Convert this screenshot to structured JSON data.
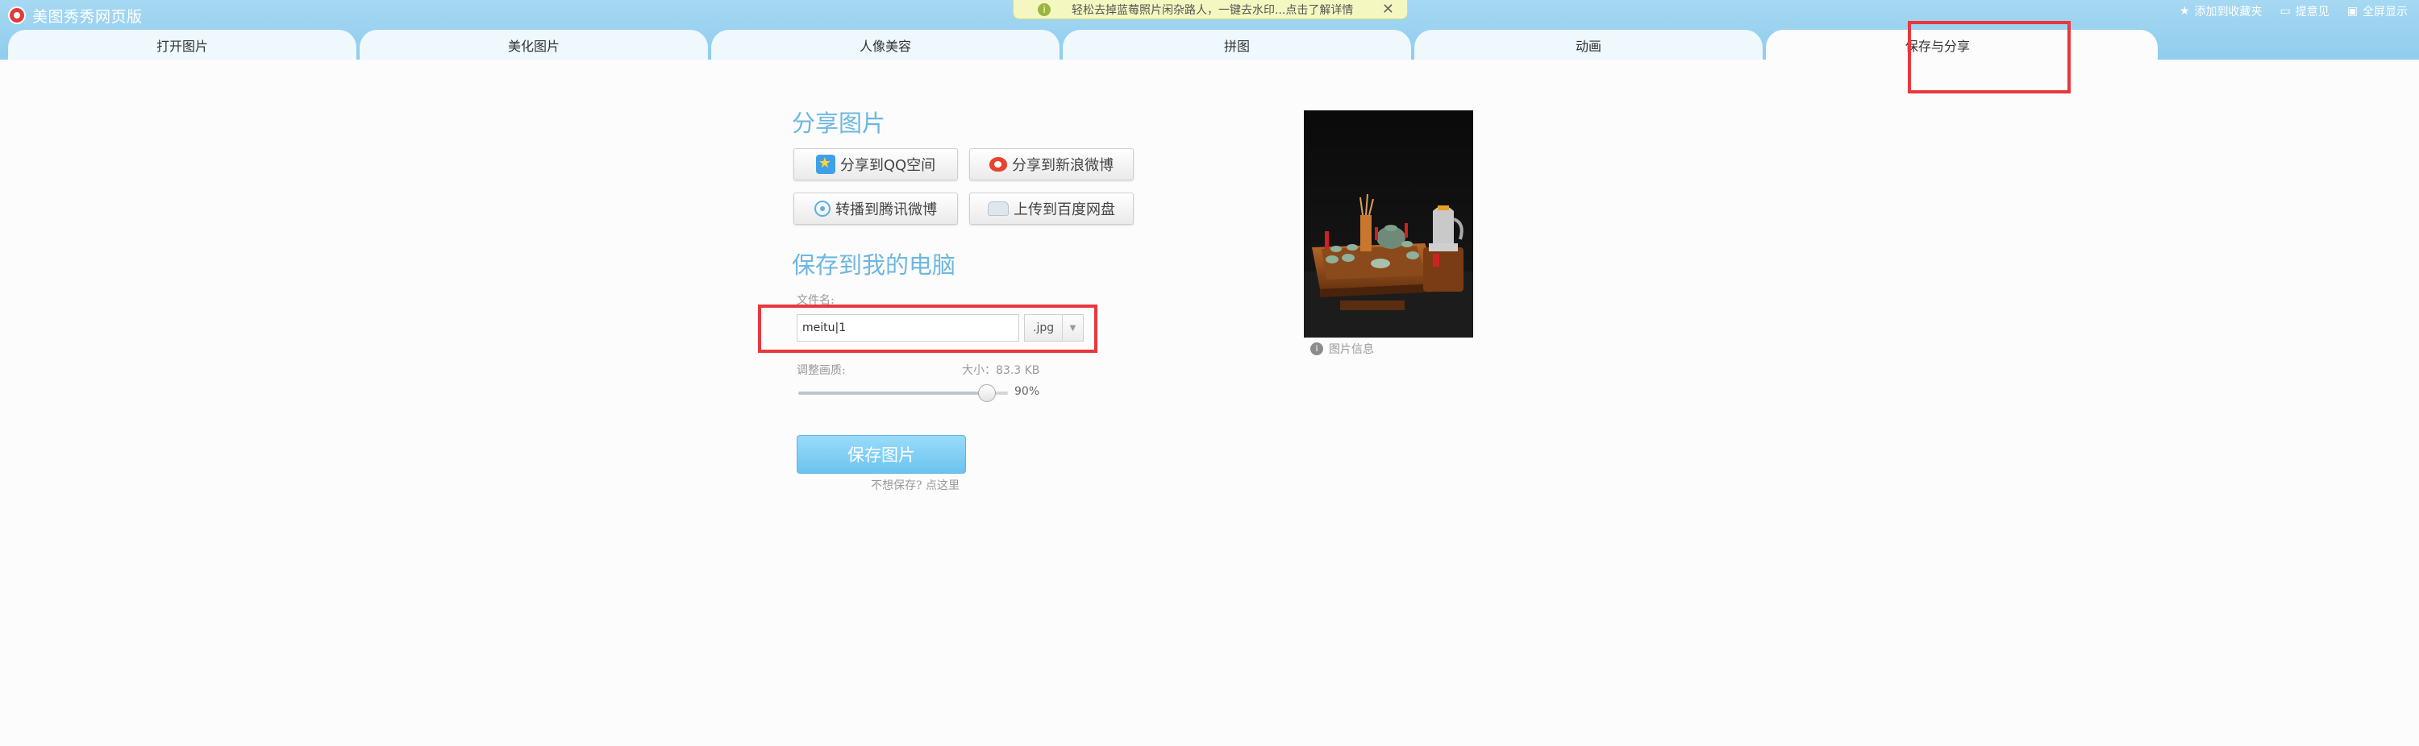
{
  "app": {
    "title": "美图秀秀网页版"
  },
  "notice": {
    "text": "轻松去掉蓝莓照片闲杂路人，一键去水印...点击了解详情",
    "close_label": "✕",
    "info_icon": "i"
  },
  "top_links": [
    {
      "label": "添加到收藏夹",
      "icon": "star-icon",
      "glyph": "★"
    },
    {
      "label": "提意见",
      "icon": "comment-icon",
      "glyph": "▭"
    },
    {
      "label": "全屏显示",
      "icon": "fullscreen-icon",
      "glyph": "▣"
    }
  ],
  "tabs": [
    {
      "label": "打开图片"
    },
    {
      "label": "美化图片"
    },
    {
      "label": "人像美容"
    },
    {
      "label": "拼图"
    },
    {
      "label": "动画"
    },
    {
      "label": "保存与分享",
      "active": true
    }
  ],
  "share": {
    "title": "分享图片",
    "buttons": [
      {
        "label": "分享到QQ空间",
        "icon": "qzone-icon"
      },
      {
        "label": "分享到新浪微博",
        "icon": "sina-weibo-icon"
      },
      {
        "label": "转播到腾讯微博",
        "icon": "tencent-weibo-icon"
      },
      {
        "label": "上传到百度网盘",
        "icon": "baidu-pan-icon"
      }
    ]
  },
  "save": {
    "title": "保存到我的电脑",
    "filename_label": "文件名:",
    "filename_value": "meitu|1",
    "format_value": ".jpg",
    "quality_label": "调整画质:",
    "size_text": "大小：83.3 KB",
    "quality_value": 90,
    "quality_text": "90%",
    "save_label": "保存图片",
    "cancel_label": "不想保存? 点这里"
  },
  "preview": {
    "info_label": "图片信息",
    "info_icon": "i"
  },
  "colors": {
    "accent": "#6db7e0",
    "header": "#9dd3f0",
    "highlight": "#e8383d",
    "save_button": "#7fcdf4"
  }
}
